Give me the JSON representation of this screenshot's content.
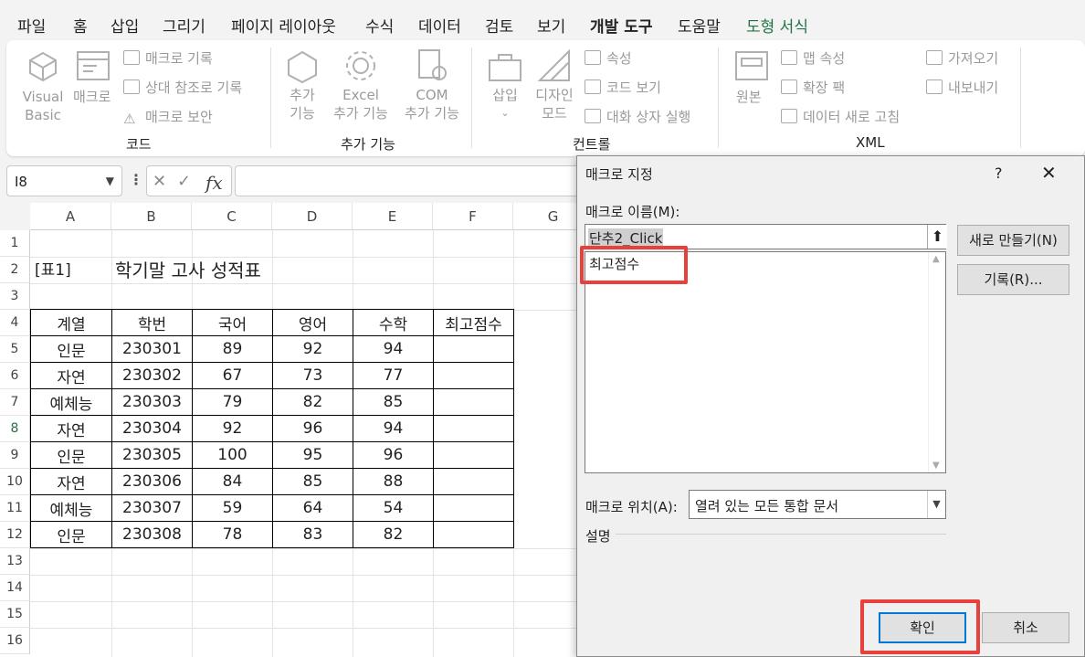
{
  "menu": {
    "tabs": [
      "파일",
      "홈",
      "삽입",
      "그리기",
      "페이지 레이아웃",
      "수식",
      "데이터",
      "검토",
      "보기",
      "개발 도구",
      "도움말",
      "도형 서식"
    ]
  },
  "ribbon": {
    "code": {
      "group_label": "코드",
      "visual_basic": [
        "Visual",
        "Basic"
      ],
      "macro": "매크로",
      "record_macro": "매크로 기록",
      "relative_ref": "상대 참조로 기록",
      "macro_security": "매크로 보안"
    },
    "addins": {
      "group_label": "추가 기능",
      "addins": [
        "추가",
        "기능"
      ],
      "excel_addins": [
        "Excel",
        "추가 기능"
      ],
      "com_addins": [
        "COM",
        "추가 기능"
      ]
    },
    "controls": {
      "group_label": "컨트롤",
      "insert": "삽입",
      "design_mode": [
        "디자인",
        "모드"
      ],
      "properties": "속성",
      "view_code": "코드 보기",
      "run_dialog": "대화 상자 실행"
    },
    "xml": {
      "group_label": "XML",
      "source": "원본",
      "map_properties": "맵 속성",
      "expansion_packs": "확장 팩",
      "refresh_data": "데이터 새로 고침",
      "import": "가져오기",
      "export": "내보내기"
    }
  },
  "formula_bar": {
    "name_box": "I8",
    "fx": "fx"
  },
  "sheet": {
    "columns": [
      "A",
      "B",
      "C",
      "D",
      "E",
      "F",
      "G"
    ],
    "rows": [
      "1",
      "2",
      "3",
      "4",
      "5",
      "6",
      "7",
      "8",
      "9",
      "10",
      "11",
      "12",
      "13",
      "14",
      "15",
      "16"
    ],
    "label_a2": "[표1]",
    "title": "학기말 고사 성적표",
    "table_headers": [
      "계열",
      "학번",
      "국어",
      "영어",
      "수학",
      "최고점수"
    ],
    "table_rows": [
      [
        "인문",
        "230301",
        "89",
        "92",
        "94",
        ""
      ],
      [
        "자연",
        "230302",
        "67",
        "73",
        "77",
        ""
      ],
      [
        "예체능",
        "230303",
        "79",
        "82",
        "85",
        ""
      ],
      [
        "자연",
        "230304",
        "92",
        "96",
        "94",
        ""
      ],
      [
        "인문",
        "230305",
        "100",
        "95",
        "96",
        ""
      ],
      [
        "자연",
        "230306",
        "84",
        "85",
        "88",
        ""
      ],
      [
        "예체능",
        "230307",
        "59",
        "64",
        "54",
        ""
      ],
      [
        "인문",
        "230308",
        "78",
        "83",
        "82",
        ""
      ]
    ]
  },
  "dialog": {
    "title": "매크로 지정",
    "help": "?",
    "close": "✕",
    "macro_name_label": "매크로 이름(M):",
    "macro_name_value": "단추2_Click",
    "list_items": [
      "최고점수"
    ],
    "new_button": "새로 만들기(N)",
    "record_button": "기록(R)...",
    "location_label": "매크로 위치(A):",
    "location_value": "열려 있는 모든 통합 문서",
    "description_label": "설명",
    "ok_button": "확인",
    "cancel_button": "취소"
  },
  "colors": {
    "accent": "#217346",
    "highlight": "#e8403a",
    "focus": "#0078d7"
  }
}
